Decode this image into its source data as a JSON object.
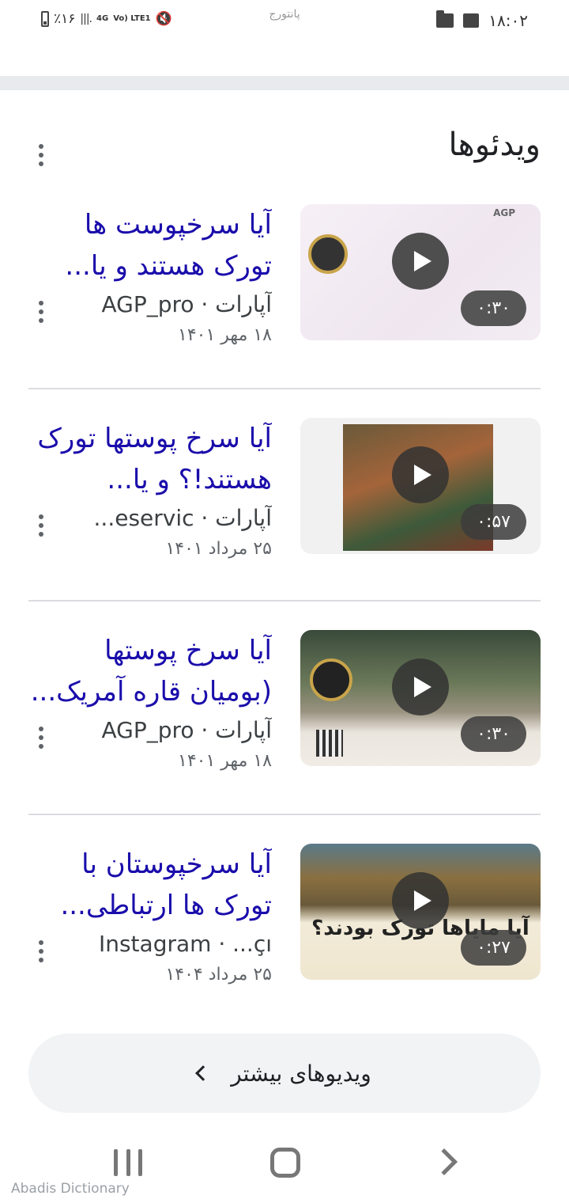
{
  "status_bar": {
    "time": "۱۸:۰۲",
    "battery": "٪۱۶",
    "network": "4G",
    "volte": "Vo) LTE1",
    "center_label": "پانتورج"
  },
  "section": {
    "title": "ویدئوها"
  },
  "videos": [
    {
      "title": "آیا سرخپوست ها تورک هستند و یا...",
      "source": "آپارات · AGP_pro",
      "date": "۱۸ مهر ۱۴۰۱",
      "duration": "۰:۳۰",
      "thumb_tag": "AGP"
    },
    {
      "title": "آیا سرخ پوستها تورک هستند!؟ و یا...",
      "source": "آپارات · eservic...",
      "date": "۲۵ مرداد ۱۴۰۱",
      "duration": "۰:۵۷"
    },
    {
      "title": "آیا سرخ پوستها (بومیان قاره آمریک...",
      "source": "آپارات · AGP_pro",
      "date": "۱۸ مهر ۱۴۰۱",
      "duration": "۰:۳۰"
    },
    {
      "title": "آیا سرخپوستان با تورک ها ارتباطی...",
      "source": "Instagram · ...çı",
      "date": "۲۵ مرداد ۱۴۰۴",
      "duration": "۰:۲۷",
      "thumb_banner": "آیا مایاها تورک بودند؟"
    }
  ],
  "more_button": {
    "label": "ویدیوهای بیشتر"
  },
  "watermark": "Abadis Dictionary"
}
